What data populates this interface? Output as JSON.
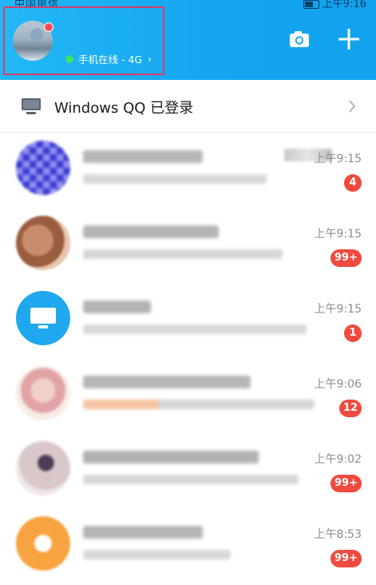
{
  "status_bar": {
    "carrier": "中国电信",
    "time": "上午9:16"
  },
  "header": {
    "online_status": "手机在线 - 4G",
    "icons": [
      "camera-icon",
      "plus-icon"
    ],
    "accent": "#12a2ee"
  },
  "device_row": {
    "label": "Windows QQ 已登录",
    "icon": "computer-icon"
  },
  "chats": [
    {
      "time": "上午9:15",
      "badge": "4"
    },
    {
      "time": "上午9:15",
      "badge": "99+"
    },
    {
      "time": "上午9:15",
      "badge": "1"
    },
    {
      "time": "上午9:06",
      "badge": "12"
    },
    {
      "time": "上午9:02",
      "badge": "99+"
    },
    {
      "time": "上午8:53",
      "badge": "99+"
    }
  ]
}
